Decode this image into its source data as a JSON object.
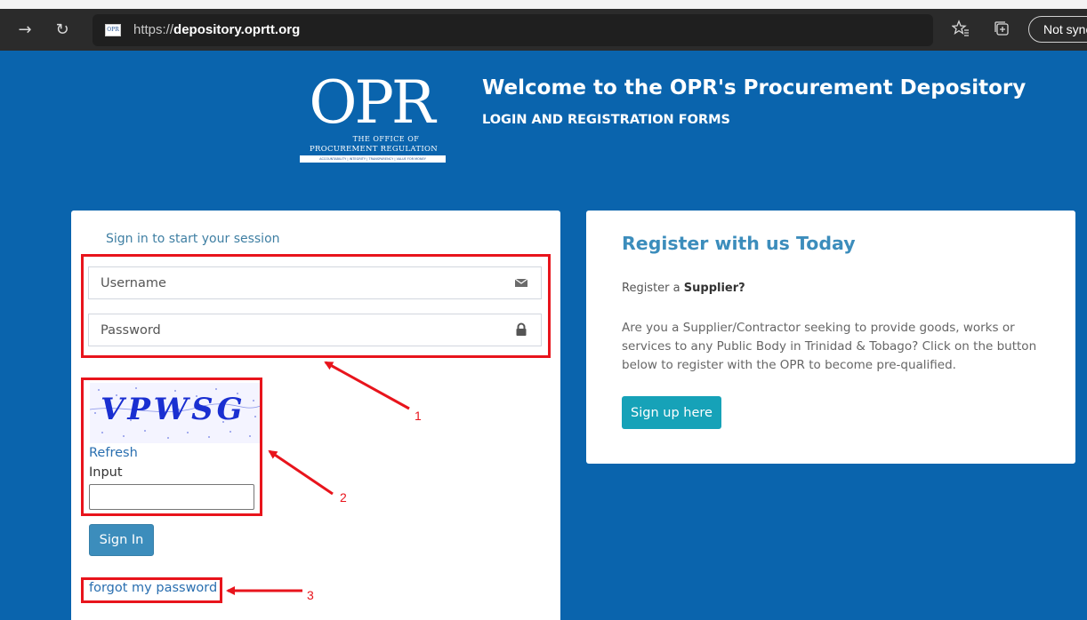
{
  "browser": {
    "url_prefix": "https://",
    "url_domain": "depository.oprtt.org",
    "favicon_text": "OPR",
    "sync_label": "Not sync",
    "icons": [
      "forward-icon",
      "refresh-icon",
      "favorites-icon",
      "collections-icon"
    ]
  },
  "header": {
    "logo": {
      "letters": "OPR",
      "line1": "THE OFFICE OF",
      "line2": "PROCUREMENT REGULATION",
      "tagline": "ACCOUNTABILITY | INTEGRITY | TRANSPARENCY | VALUE FOR MONEY"
    },
    "title": "Welcome to the OPR's Procurement Depository",
    "subtitle": "LOGIN AND REGISTRATION FORMS"
  },
  "login": {
    "session_message": "Sign in to start your session",
    "username_placeholder": "Username",
    "password_placeholder": "Password",
    "captcha_text": "VPWSG",
    "refresh_label": "Refresh",
    "input_label": "Input",
    "signin_label": "Sign In",
    "forgot_label": "forgot my password"
  },
  "register": {
    "title": "Register with us Today",
    "supplier_prefix": "Register a ",
    "supplier_bold": "Supplier?",
    "description": "Are you a Supplier/Contractor seeking to provide goods, works or services to any Public Body in Trinidad & Tobago? Click on the button below to register with the OPR to become pre-qualified.",
    "signup_label": "Sign up here"
  },
  "annotations": {
    "color": "#e8141c",
    "labels": [
      "1",
      "2",
      "3"
    ]
  },
  "colors": {
    "page_background": "#0a64ad",
    "primary_button": "#3c8dbc",
    "signup_button": "#16a2b8",
    "link": "#2a6fb0"
  }
}
